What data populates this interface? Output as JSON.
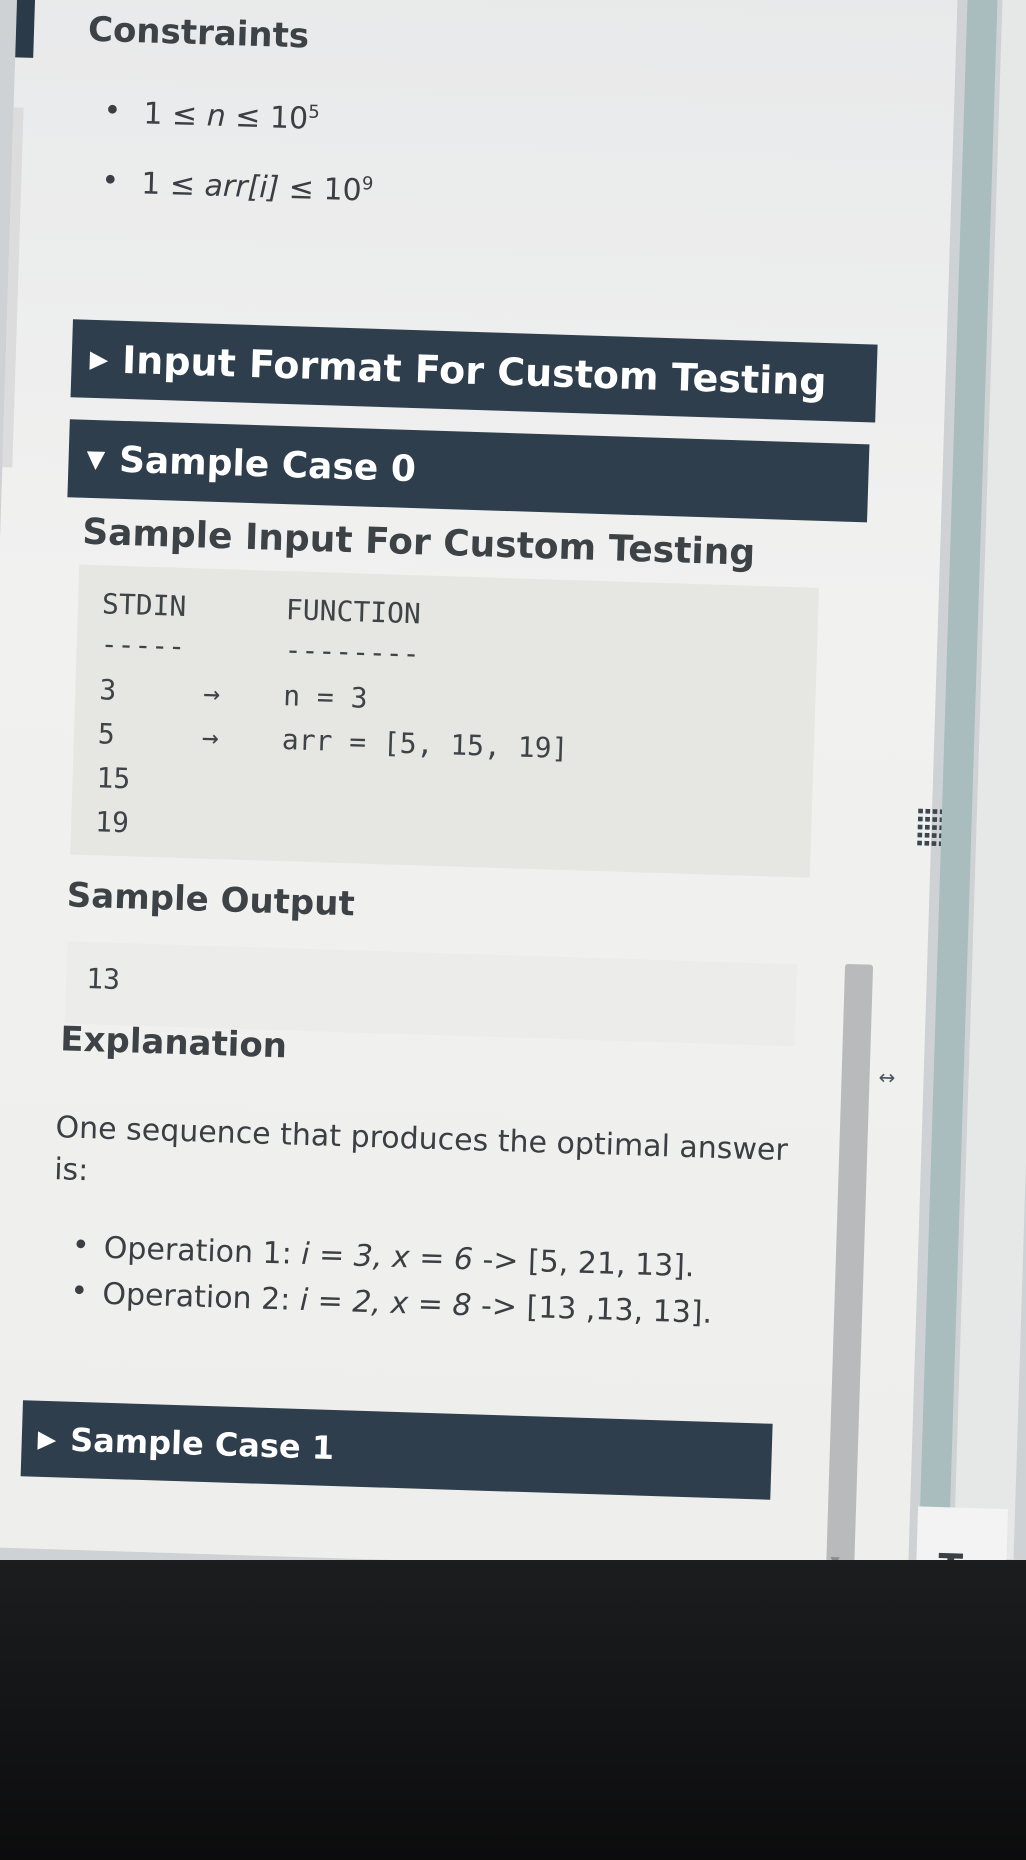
{
  "constraints": {
    "heading": "Constraints",
    "items": [
      {
        "prefix": "1 ≤ ",
        "var": "n",
        "suffix": " ≤ 10",
        "exp": "5"
      },
      {
        "prefix": "1 ≤ ",
        "var": "arr[i]",
        "suffix": " ≤ 10",
        "exp": "9"
      }
    ]
  },
  "sections": {
    "input_format": "Input Format For Custom Testing",
    "sample_case_0": "Sample Case 0",
    "sample_case_1": "Sample Case 1"
  },
  "sample0": {
    "input_heading": "Sample Input For Custom Testing",
    "stdin_header": "STDIN",
    "function_header": "FUNCTION",
    "stdin_dash": "-----",
    "function_dash": "--------",
    "rows": [
      {
        "stdin": "3",
        "arrow": "→",
        "func": "n = 3"
      },
      {
        "stdin": "5",
        "arrow": "→",
        "func": "arr = [5, 15, 19]"
      },
      {
        "stdin": "15",
        "arrow": "",
        "func": ""
      },
      {
        "stdin": "19",
        "arrow": "",
        "func": ""
      }
    ],
    "output_heading": "Sample Output",
    "output_value": "13",
    "explanation_heading": "Explanation",
    "explanation_text": "One sequence that produces the optimal answer is:",
    "operations": [
      {
        "label": "Operation 1: ",
        "vars": "i = 3, x = 6",
        "result": " -> [5, 21, 13]."
      },
      {
        "label": "Operation 2: ",
        "vars": "i = 2, x = 8",
        "result": " -> [13 ,13, 13]."
      }
    ]
  },
  "tab_label": "Tes",
  "icons": {
    "caret_collapsed": "▶",
    "caret_expanded": "▼",
    "resize": "↔",
    "grip": "drag-handle"
  }
}
